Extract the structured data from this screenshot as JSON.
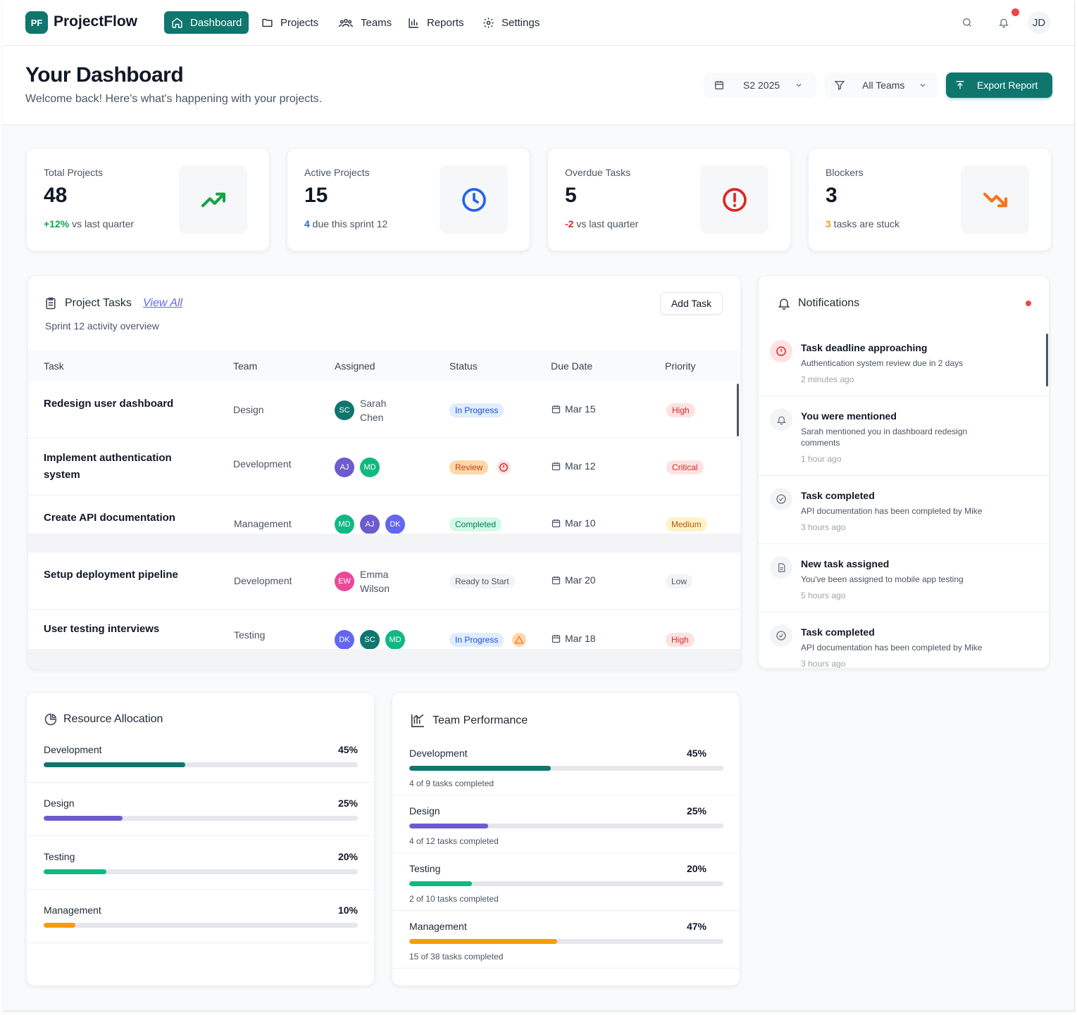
{
  "app": {
    "logo_initials": "PF",
    "name": "ProjectFlow",
    "user_initials": "JD"
  },
  "nav": {
    "items": [
      {
        "label": "Dashboard",
        "icon": "home-icon",
        "active": true
      },
      {
        "label": "Projects",
        "icon": "folder-icon"
      },
      {
        "label": "Teams",
        "icon": "users-icon"
      },
      {
        "label": "Reports",
        "icon": "bar-chart-icon"
      },
      {
        "label": "Settings",
        "icon": "gear-icon"
      }
    ]
  },
  "header": {
    "title": "Your Dashboard",
    "subtitle": "Welcome back! Here's what's happening with your projects.",
    "period": "S2 2025",
    "team_filter": "All Teams",
    "export_label": "Export Report"
  },
  "stats": [
    {
      "label": "Total Projects",
      "value": "48",
      "note_highlight": "+12%",
      "note_text": " vs last quarter",
      "highlight_color": "#16a34a",
      "icon": "trending-up-icon"
    },
    {
      "label": "Active Projects",
      "value": "15",
      "note_highlight": "4",
      "note_text": " due this sprint 12",
      "highlight_color": "#2563eb",
      "icon": "clock-icon"
    },
    {
      "label": "Overdue Tasks",
      "value": "5",
      "note_highlight": "-2",
      "note_text": " vs last quarter",
      "highlight_color": "#dc2626",
      "icon": "alert-circle-icon"
    },
    {
      "label": "Blockers",
      "value": "3",
      "note_highlight": "3",
      "note_text": " tasks are stuck",
      "highlight_color": "#f59e0b",
      "icon": "trending-down-icon"
    }
  ],
  "tasks": {
    "title": "Project Tasks",
    "view_all": "View All",
    "subtitle": "Sprint 12 activity overview",
    "add_label": "Add Task",
    "columns": [
      "Task",
      "Team",
      "Assigned",
      "Status",
      "Due Date",
      "Priority"
    ],
    "rows": [
      {
        "task": "Redesign user dashboard",
        "team": "Design",
        "assignees": [
          "SC"
        ],
        "assignee_name": "Sarah Chen",
        "status": "In Progress",
        "due": "Mar 15",
        "priority": "High"
      },
      {
        "task": "Implement authentication system",
        "team": "Development",
        "assignees": [
          "AJ",
          "MD"
        ],
        "assignee_name": "",
        "status": "Review",
        "due": "Mar 12",
        "priority": "Critical"
      },
      {
        "task": "Create API documentation",
        "team": "Management",
        "assignees": [
          "MD",
          "AJ",
          "DK"
        ],
        "assignee_name": "",
        "status": "Completed",
        "due": "Mar 10",
        "priority": "Medium"
      },
      {
        "task": "Setup deployment pipeline",
        "team": "Development",
        "assignees": [
          "EW"
        ],
        "assignee_name": "Emma Wilson",
        "status": "Ready to Start",
        "due": "Mar 20",
        "priority": "Low"
      },
      {
        "task": "User testing interviews",
        "team": "Testing",
        "assignees": [
          "DK",
          "SC",
          "MD"
        ],
        "assignee_name": "",
        "status": "In Progress",
        "due": "Mar 18",
        "priority": "High"
      }
    ],
    "avatar_colors": {
      "SC": "#0f766e",
      "AJ": "#6d5bd0",
      "MD": "#10b981",
      "DK": "#6366f1",
      "EW": "#ec4899"
    }
  },
  "notifications": {
    "title": "Notifications",
    "items": [
      {
        "title": "Task deadline approaching",
        "desc": "Authentication system review due in 2 days",
        "time": "2 minutes ago",
        "icon": "alert-circle-icon"
      },
      {
        "title": "You were mentioned",
        "desc": "Sarah mentioned you in dashboard redesign comments",
        "time": "1 hour ago",
        "icon": "bell-icon"
      },
      {
        "title": "Task completed",
        "desc": "API documentation has been completed by Mike",
        "time": "3 hours ago",
        "icon": "check-circle-icon"
      },
      {
        "title": "New task assigned",
        "desc": "You've been assigned to mobile app testing",
        "time": "5 hours ago",
        "icon": "document-icon"
      },
      {
        "title": "Task completed",
        "desc": "API documentation has been completed by Mike",
        "time": "3 hours ago",
        "icon": "check-circle-icon"
      }
    ]
  },
  "resource_allocation": {
    "title": "Resource Allocation",
    "items": [
      {
        "label": "Development",
        "pct_label": "45%",
        "fraction": 0.45,
        "color": "#0f766e"
      },
      {
        "label": "Design",
        "pct_label": "25%",
        "fraction": 0.25,
        "color": "#6d5bd0"
      },
      {
        "label": "Testing",
        "pct_label": "20%",
        "fraction": 0.2,
        "color": "#10b981"
      },
      {
        "label": "Management",
        "pct_label": "10%",
        "fraction": 0.1,
        "color": "#f59e0b"
      }
    ]
  },
  "team_performance": {
    "title": "Team Performance",
    "items": [
      {
        "label": "Development",
        "pct_label": "45%",
        "fraction": 0.45,
        "color": "#0f766e",
        "sub": "4 of 9 tasks completed"
      },
      {
        "label": "Design",
        "pct_label": "25%",
        "fraction": 0.25,
        "color": "#6d5bd0",
        "sub": "4 of 12 tasks completed"
      },
      {
        "label": "Testing",
        "pct_label": "20%",
        "fraction": 0.2,
        "color": "#10b981",
        "sub": "2 of 10 tasks completed"
      },
      {
        "label": "Management",
        "pct_label": "47%",
        "fraction": 0.47,
        "color": "#f59e0b",
        "sub": "15 of 38 tasks completed"
      }
    ]
  }
}
